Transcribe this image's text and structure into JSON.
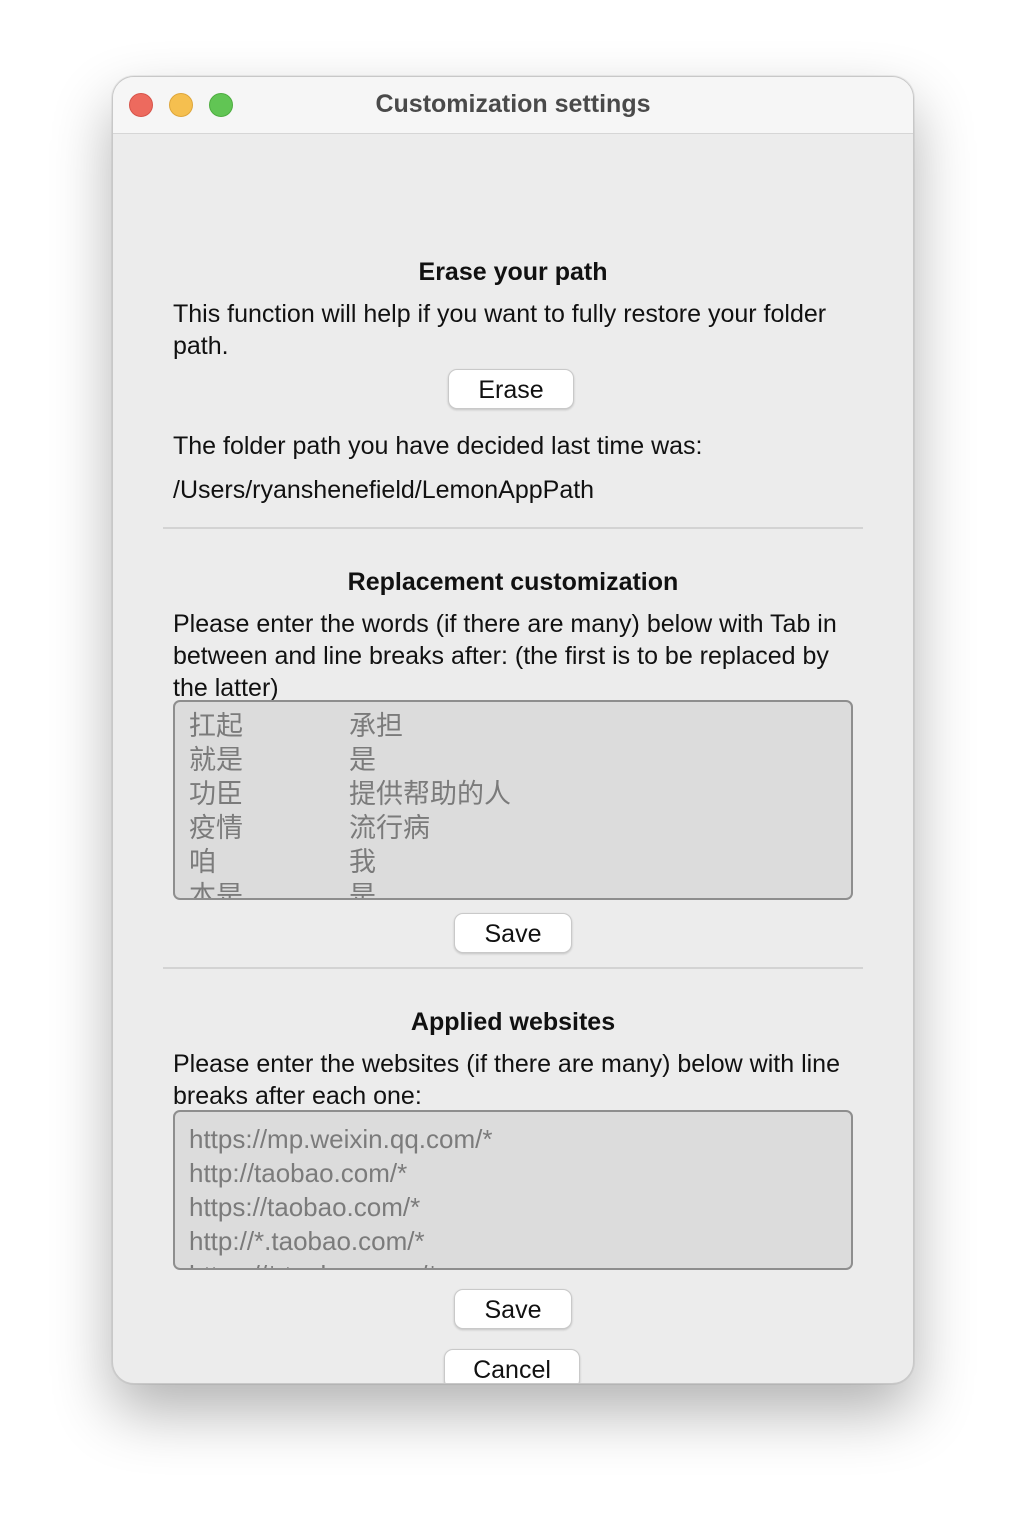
{
  "window": {
    "title": "Customization settings"
  },
  "erase_section": {
    "title": "Erase your path",
    "description": "This function will help if you want to fully restore your folder path.",
    "erase_label": "Erase",
    "last_path_label": "The folder path you have decided last time was:",
    "last_path_value": "/Users/ryanshenefield/LemonAppPath"
  },
  "replacement_section": {
    "title": "Replacement customization",
    "description": "Please enter the words (if there are many) below with Tab in between and line breaks after: (the first is to be replaced by the latter)",
    "rows": [
      {
        "from": "扛起",
        "to": "承担"
      },
      {
        "from": "就是",
        "to": "是"
      },
      {
        "from": "功臣",
        "to": "提供帮助的人"
      },
      {
        "from": "疫情",
        "to": "流行病"
      },
      {
        "from": "咱",
        "to": "我"
      },
      {
        "from": "本是",
        "to": "是"
      }
    ],
    "save_label": "Save"
  },
  "websites_section": {
    "title": "Applied websites",
    "description": "Please enter the websites (if there are many) below with line breaks after each one:",
    "urls": [
      "https://mp.weixin.qq.com/*",
      "http://taobao.com/*",
      "https://taobao.com/*",
      "http://*.taobao.com/*",
      "https://*.taobao.com/*"
    ],
    "save_label": "Save"
  },
  "footer": {
    "cancel_label": "Cancel"
  }
}
